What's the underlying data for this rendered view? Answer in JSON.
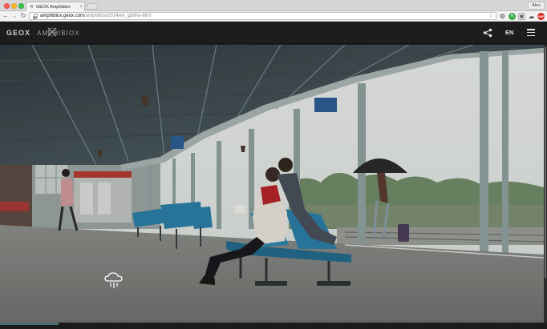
{
  "browser": {
    "tab_title": "GEOX Amphibiox",
    "tab_favicon": "✕",
    "profile_name": "Alex",
    "url_scheme": "",
    "url_host": "amphibiox.geox.com",
    "url_path": "/amphibiox2014/en_gb/the-film/"
  },
  "site": {
    "brand": "GEOX",
    "product": "AMPHIBIOX",
    "language": "EN"
  },
  "video": {
    "progress": 0.107
  },
  "colors": {
    "header_bg": "#1d1d1d",
    "progress_fill": "#4a6e74"
  },
  "icons": {
    "share": "share-icon",
    "menu": "hamburger-menu-icon",
    "rain_cursor": "rain-cloud-icon"
  }
}
